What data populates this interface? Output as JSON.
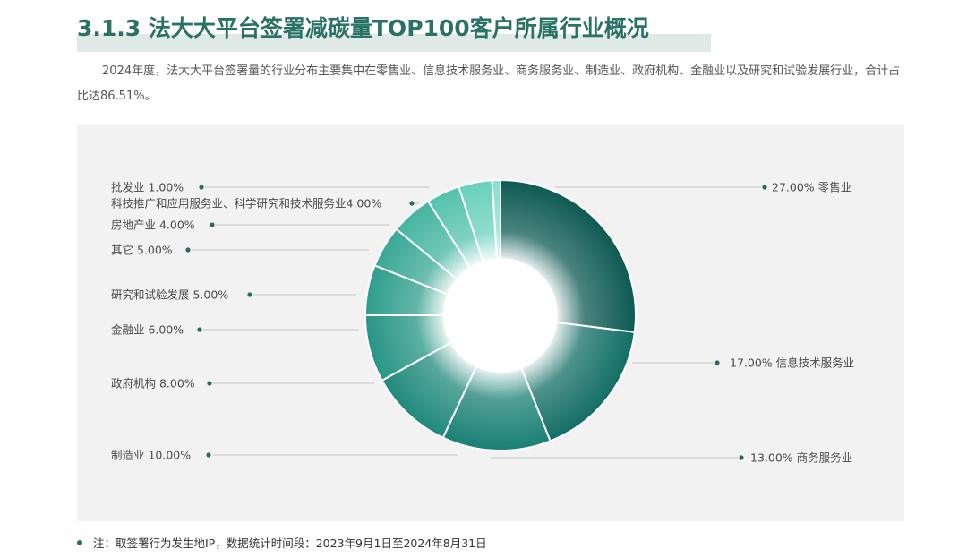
{
  "header": {
    "title": "3.1.3 法大大平台签署减碳量TOP100客户所属行业概况"
  },
  "intro": {
    "text": "2024年度，法大大平台签署量的行业分布主要集中在零售业、信息技术服务业、商务服务业、制造业、政府机构、金融业以及研究和试验发展行业，合计占比达86.51%。"
  },
  "footer": {
    "note": "注：取签署行为发生地IP，数据统计时间段：2023年9月1日至2024年8月31日"
  },
  "colors": {
    "dot": "#2a6b63",
    "leader": "#c4c4c4",
    "panel": "#f2f2f2"
  },
  "chart_data": {
    "type": "pie",
    "donut": true,
    "legend": "none",
    "slices": [
      {
        "name": "零售业",
        "value": 27.0,
        "label": "27.00%  零售业",
        "color": "#0e5a53"
      },
      {
        "name": "信息技术服务业",
        "value": 17.0,
        "label": "17.00% 信息技术服务业",
        "color": "#136e65"
      },
      {
        "name": "商务服务业",
        "value": 13.0,
        "label": "13.00%  商务服务业",
        "color": "#1a8074"
      },
      {
        "name": "制造业",
        "value": 10.0,
        "label": "制造业  10.00%",
        "color": "#20897c"
      },
      {
        "name": "政府机构",
        "value": 8.0,
        "label": "政府机构 8.00%",
        "color": "#279585"
      },
      {
        "name": "金融业",
        "value": 6.0,
        "label": "金融业  6.00%",
        "color": "#2f9e8c"
      },
      {
        "name": "研究和试验发展",
        "value": 5.0,
        "label": "研究和试验发展  5.00%",
        "color": "#39a895"
      },
      {
        "name": "其它",
        "value": 5.0,
        "label": "其它  5.00%",
        "color": "#45b5a0"
      },
      {
        "name": "房地产业",
        "value": 4.0,
        "label": "房地产业  4.00%",
        "color": "#54c2ab"
      },
      {
        "name": "科技推广和应用服务业、科学研究和技术服务业",
        "value": 4.0,
        "label": "科技推广和应用服务业、科学研究和技术服务业4.00%",
        "color": "#68d1bb"
      },
      {
        "name": "批发业",
        "value": 1.0,
        "label": "批发业  1.00%",
        "color": "#86e0cc"
      }
    ]
  }
}
